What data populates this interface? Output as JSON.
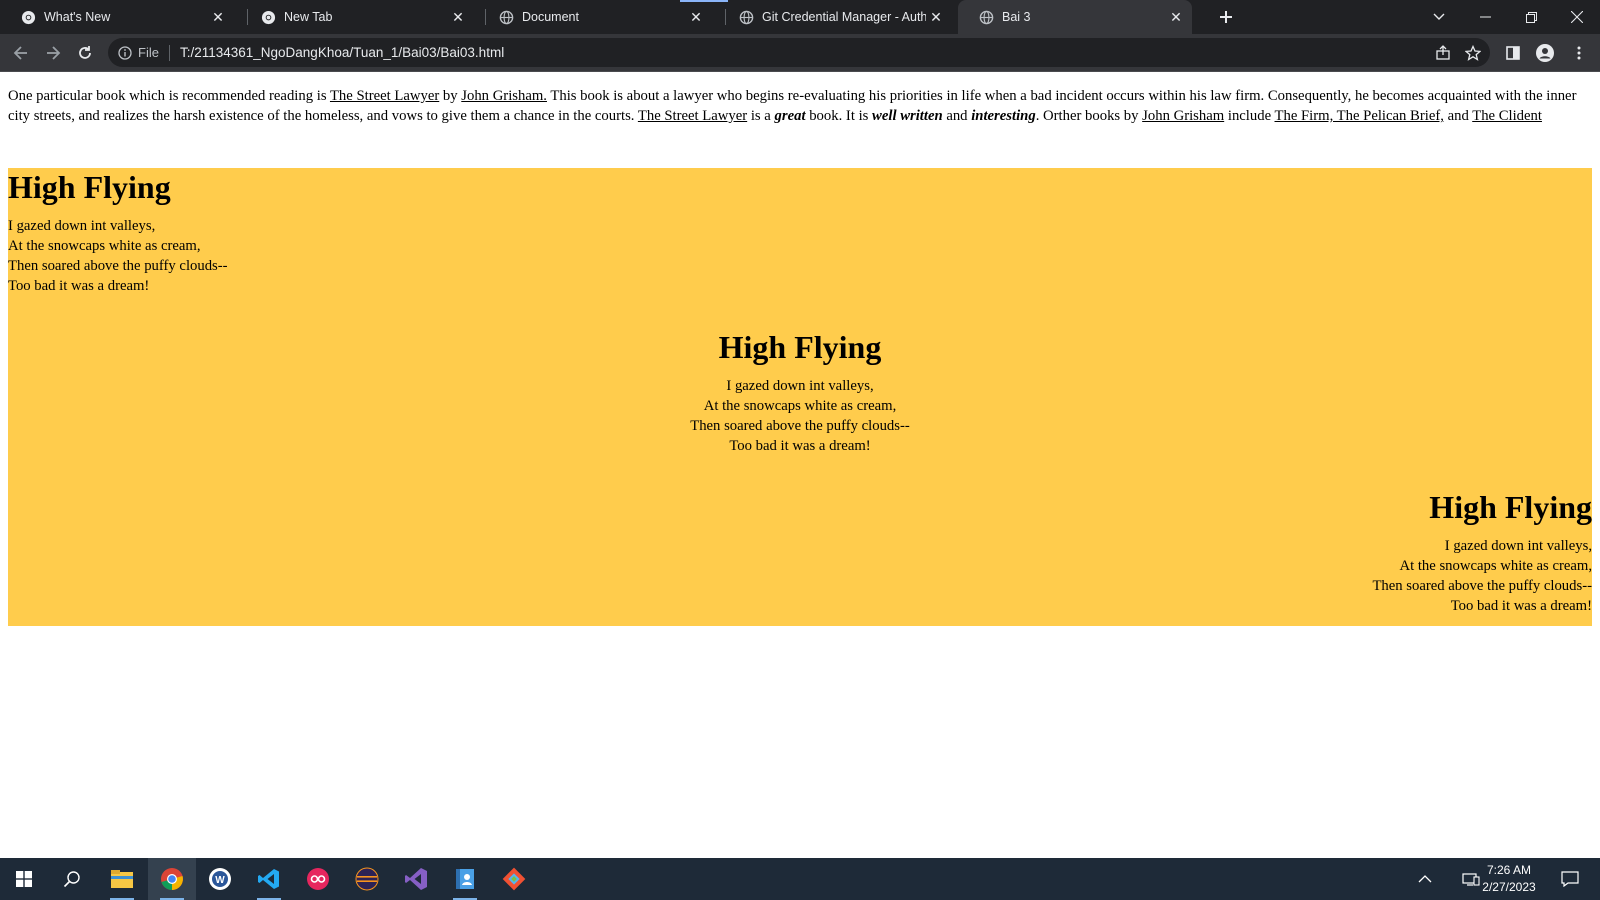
{
  "browser": {
    "tabs": [
      {
        "title": "What's New",
        "icon": "chrome-icon",
        "active": false
      },
      {
        "title": "New Tab",
        "icon": "chrome-icon",
        "active": false
      },
      {
        "title": "Document",
        "icon": "globe-icon",
        "active": false
      },
      {
        "title": "Git Credential Manager - Authent",
        "icon": "globe-icon",
        "active": false
      },
      {
        "title": "Bai 3",
        "icon": "globe-icon",
        "active": true
      }
    ],
    "address": {
      "scheme_label": "File",
      "url": "T:/21134361_NgoDangKhoa/Tuan_1/Bai03/Bai03.html"
    }
  },
  "page": {
    "intro": {
      "t1": "One particular book which is recommended reading is ",
      "link1": "The Street Lawyer",
      "t2": " by ",
      "link2": "John Grisham.",
      "t3": " This book is about a lawyer who begins re-evaluating his priorities in life when a bad incident occurs within his law firm. Consequently, he becomes acquainted with the inner city streets, and realizes the harsh existence of the homeless, and vows to give them a chance in the courts. ",
      "link3": "The Street Lawyer",
      "t4": " is a ",
      "great": "great",
      "t5": " book. It is ",
      "well_written": "well written",
      "t6": " and ",
      "interesting": "interesting",
      "t7": ". Orther books by ",
      "link4": "John Grisham",
      "t8": " include ",
      "link5": "The Firm, The Pelican Brief,",
      "t9": " and ",
      "link6": "The Clident"
    },
    "poem": {
      "title": "High Flying",
      "lines": [
        "I gazed down int valleys,",
        "At the snowcaps white as cream,",
        "Then soared above the puffy clouds--",
        "Too bad it was a dream!"
      ]
    },
    "background_color": "#ffcc4c"
  },
  "taskbar": {
    "apps": [
      "file-explorer-icon",
      "chrome-icon",
      "app-w-icon",
      "vscode-icon",
      "app-oo-icon",
      "eclipse-icon",
      "visual-studio-icon",
      "app-contacts-icon",
      "git-icon"
    ],
    "clock": {
      "time": "7:26 AM",
      "date": "2/27/2023"
    }
  }
}
